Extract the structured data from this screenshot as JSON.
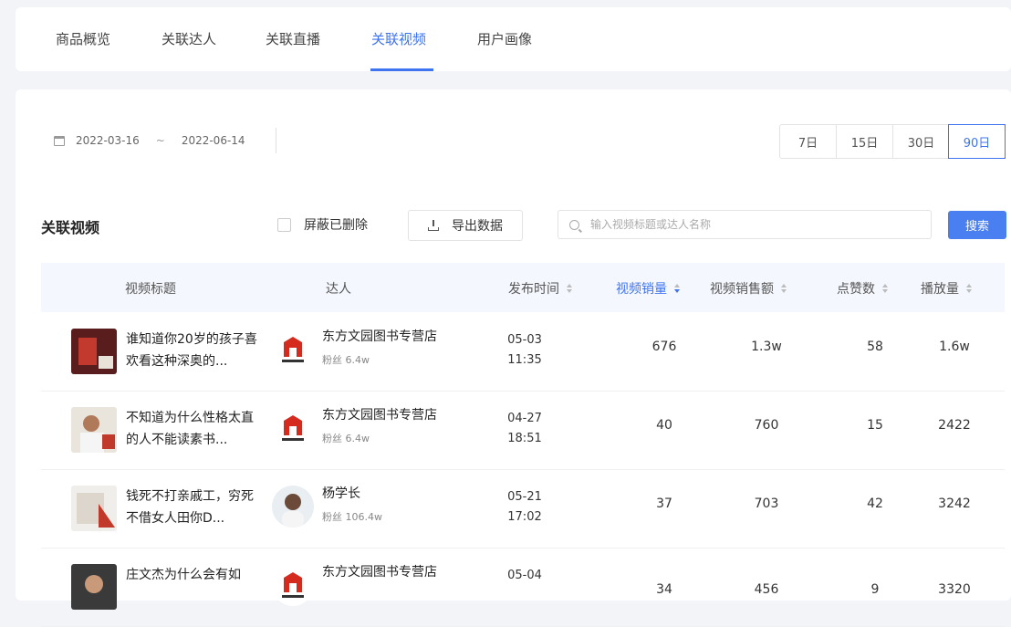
{
  "tabs": [
    "商品概览",
    "关联达人",
    "关联直播",
    "关联视频",
    "用户画像"
  ],
  "active_tab": 3,
  "date_range": {
    "start": "2022-03-16",
    "sep": "~",
    "end": "2022-06-14"
  },
  "range_buttons": [
    "7日",
    "15日",
    "30日",
    "90日"
  ],
  "active_range": 3,
  "section_title": "关联视频",
  "filter_checkbox_label": "屏蔽已删除",
  "export_label": "导出数据",
  "search": {
    "placeholder": "输入视频标题或达人名称",
    "button_label": "搜索"
  },
  "columns": [
    "视频标题",
    "达人",
    "发布时间",
    "视频销量",
    "视频销售额",
    "点赞数",
    "播放量"
  ],
  "rows": [
    {
      "title": "谁知道你20岁的孩子喜欢看这种深奥的...",
      "influencer": "东方文园图书专营店",
      "fans": "粉丝 6.4w",
      "date": "05-03",
      "time": "11:35",
      "sales": "676",
      "revenue": "1.3w",
      "likes": "58",
      "plays": "1.6w"
    },
    {
      "title": "不知道为什么性格太直的人不能读素书...",
      "influencer": "东方文园图书专营店",
      "fans": "粉丝 6.4w",
      "date": "04-27",
      "time": "18:51",
      "sales": "40",
      "revenue": "760",
      "likes": "15",
      "plays": "2422"
    },
    {
      "title": "钱死不打亲戚工，穷死不借女人田你D...",
      "influencer": "杨学长",
      "fans": "粉丝 106.4w",
      "date": "05-21",
      "time": "17:02",
      "sales": "37",
      "revenue": "703",
      "likes": "42",
      "plays": "3242"
    },
    {
      "title": "庄文杰为什么会有如",
      "influencer": "东方文园图书专营店",
      "fans": "",
      "date": "05-04",
      "time": "",
      "sales": "34",
      "revenue": "456",
      "likes": "9",
      "plays": "3320"
    }
  ],
  "colors": {
    "accent": "#3f74f0",
    "search_button": "#4a7ff2"
  }
}
